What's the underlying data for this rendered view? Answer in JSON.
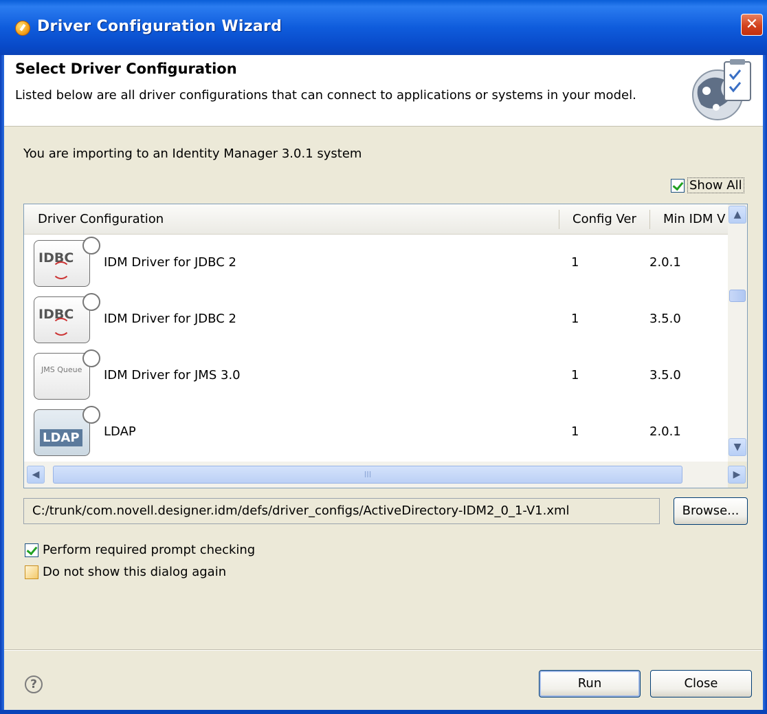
{
  "window": {
    "title": "Driver Configuration Wizard",
    "close_glyph": "✕",
    "icon": "wizard-globe-icon"
  },
  "banner": {
    "title": "Select Driver Configuration",
    "description": "Listed below are all driver configurations that can connect to applications or systems in your model.",
    "graphic": "checklist-globe-icon"
  },
  "import_text": "You are importing to an Identity Manager 3.0.1 system",
  "show_all": {
    "label": "Show All",
    "checked": true
  },
  "table": {
    "columns": [
      "Driver Configuration",
      "Config Ver",
      "Min IDM V"
    ],
    "rows": [
      {
        "icon": "jdbc-driver-icon",
        "icon_text": "IDBC",
        "name": "IDM Driver for JDBC 2",
        "config_ver": "1",
        "min_idm": "2.0.1"
      },
      {
        "icon": "jdbc-driver-icon",
        "icon_text": "IDBC",
        "name": "IDM Driver for JDBC 2",
        "config_ver": "1",
        "min_idm": "3.5.0"
      },
      {
        "icon": "jms-driver-icon",
        "icon_text": "JMS Queue",
        "name": "IDM Driver for JMS 3.0",
        "config_ver": "1",
        "min_idm": "3.5.0"
      },
      {
        "icon": "ldap-driver-icon",
        "icon_text": "LDAP",
        "name": "LDAP",
        "config_ver": "1",
        "min_idm": "2.0.1"
      }
    ],
    "scroll_up": "▲",
    "scroll_down": "▼",
    "scroll_left": "◀",
    "scroll_right": "▶",
    "h_thumb_grip": "III"
  },
  "path": "C:/trunk/com.novell.designer.idm/defs/driver_configs/ActiveDirectory-IDM2_0_1-V1.xml",
  "browse_label": "Browse...",
  "options": [
    {
      "label": "Perform required prompt checking",
      "checked": true
    },
    {
      "label": "Do not show this dialog again",
      "checked": false
    }
  ],
  "footer": {
    "help_glyph": "?",
    "run_label": "Run",
    "close_label": "Close"
  }
}
